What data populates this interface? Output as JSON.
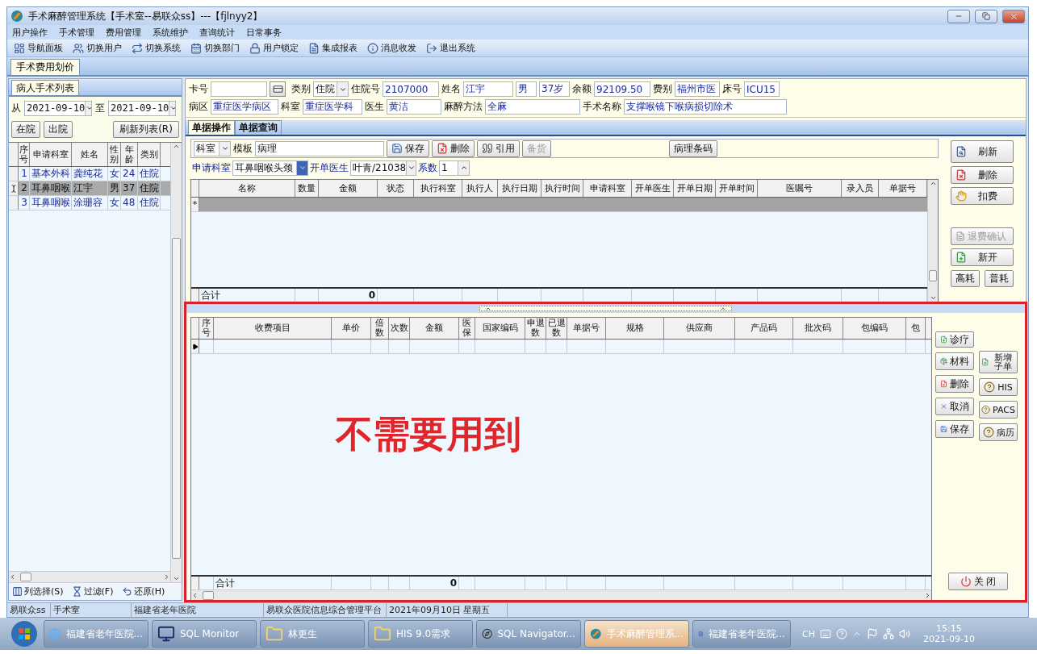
{
  "window": {
    "title": "手术麻醉管理系统【手术室--易联众ss】---【fjlnyy2】"
  },
  "menu": [
    "用户操作",
    "手术管理",
    "费用管理",
    "系统维护",
    "查询统计",
    "日常事务"
  ],
  "toolbar": [
    {
      "label": "导航面板",
      "kind": "nav"
    },
    {
      "label": "切换用户",
      "kind": "user"
    },
    {
      "label": "切换系统",
      "kind": "system"
    },
    {
      "label": "切换部门",
      "kind": "dept"
    },
    {
      "label": "用户锁定",
      "kind": "lock"
    },
    {
      "label": "集成报表",
      "kind": "report"
    },
    {
      "label": "消息收发",
      "kind": "message"
    },
    {
      "label": "退出系统",
      "kind": "exit"
    }
  ],
  "doc_tabs": [
    {
      "label": "手术费用划价",
      "selected": true
    }
  ],
  "patient_list": {
    "tab": "病人手术列表",
    "from_label": "从",
    "from": "2021-09-10",
    "to_label": "至",
    "to": "2021-09-10",
    "filters": [
      "在院",
      "出院"
    ],
    "refresh": "刷新列表(R)",
    "columns": [
      "序号",
      "申请科室",
      "姓名",
      "性别",
      "年龄",
      "类别"
    ],
    "rows": [
      {
        "cells": [
          "1",
          "基本外科",
          "龚纯花",
          "女",
          "24",
          "住院"
        ],
        "selected": false
      },
      {
        "cells": [
          "2",
          "耳鼻咽喉",
          "江宇",
          "男",
          "37",
          "住院"
        ],
        "selected": true
      },
      {
        "cells": [
          "3",
          "耳鼻咽喉",
          "涂珊容",
          "女",
          "48",
          "住院"
        ],
        "selected": false
      }
    ],
    "actions": [
      {
        "label": "列选择(S)",
        "kind": "columns"
      },
      {
        "label": "过滤(F)",
        "kind": "filter"
      },
      {
        "label": "还原(H)",
        "kind": "restore"
      }
    ]
  },
  "patient_info": {
    "lines": [
      {
        "fields": [
          {
            "label": "卡号",
            "kind": "input"
          },
          {
            "kind": "card_button"
          },
          {
            "label": "类别",
            "value": "住院",
            "kind": "select"
          },
          {
            "label": "住院号",
            "value": "2107000",
            "kind": "input"
          },
          {
            "label": "姓名",
            "value": "江宇",
            "kind": "input"
          },
          {
            "value": "男",
            "kind": "input"
          },
          {
            "value": "37岁",
            "kind": "input"
          },
          {
            "label": "余额",
            "value": "92109.50",
            "kind": "input"
          },
          {
            "label": "费别",
            "value": "福州市医",
            "kind": "input"
          },
          {
            "label": "床号",
            "value": "ICU15",
            "kind": "input"
          }
        ]
      },
      {
        "fields": [
          {
            "label": "病区",
            "value": "重症医学病区",
            "kind": "input"
          },
          {
            "label": "科室",
            "value": "重症医学科",
            "kind": "input"
          },
          {
            "label": "医生",
            "value": "黄洁",
            "kind": "input"
          },
          {
            "label": "麻醉方法",
            "value": "全麻",
            "kind": "input"
          },
          {
            "label": "手术名称",
            "value": "支撑喉镜下喉病损切除术",
            "kind": "input"
          }
        ]
      }
    ]
  },
  "order_panel": {
    "tabs": [
      {
        "label": "单据操作",
        "selected": true
      },
      {
        "label": "单据查询",
        "selected": false
      }
    ],
    "dept_select": "科室",
    "template_label": "模板",
    "template": "病理",
    "actions": [
      {
        "label": "保存",
        "kind": "save",
        "disabled": false
      },
      {
        "label": "删除",
        "kind": "delete",
        "disabled": false
      },
      {
        "label": "引用",
        "kind": "quote",
        "disabled": false
      },
      {
        "label": "备货",
        "kind": "plain",
        "disabled": true
      }
    ],
    "barcode_button": "病理条码",
    "apply_dept_label": "申请科室",
    "apply_dept": "耳鼻咽喉头颈",
    "doctor_label": "开单医生",
    "doctor": "叶青/21038",
    "factor_label": "系数",
    "factor": "1",
    "grid": {
      "columns": [
        "名称",
        "数量",
        "金额",
        "状态",
        "执行科室",
        "执行人",
        "执行日期",
        "执行时间",
        "申请科室",
        "开单医生",
        "开单日期",
        "开单时间",
        "医嘱号",
        "录入员",
        "单据号"
      ],
      "new_row_marker": "*",
      "footer": {
        "label": "合计",
        "total": "0"
      }
    },
    "side_buttons": [
      {
        "label": "刷新",
        "kind": "refresh",
        "disabled": false
      },
      {
        "label": "删除",
        "kind": "delete",
        "disabled": false
      },
      {
        "label": "扣费",
        "kind": "hand",
        "disabled": false
      },
      {
        "label": "退费确认",
        "kind": "refund",
        "disabled": true
      },
      {
        "label": "新开",
        "kind": "add",
        "disabled": false
      }
    ],
    "side_pair": [
      "高耗",
      "普耗"
    ]
  },
  "charge_panel": {
    "grid": {
      "columns": [
        "序号",
        "收费项目",
        "单价",
        "倍数",
        "次数",
        "金额",
        "医保",
        "国家编码",
        "申退数",
        "已退数",
        "单据号",
        "规格",
        "供应商",
        "产品码",
        "批次码",
        "包编码",
        "包"
      ],
      "footer": {
        "label": "合计",
        "total": "0"
      }
    },
    "buttons_left": [
      {
        "label": "诊疗",
        "kind": "add"
      },
      {
        "label": "材料",
        "kind": "material"
      },
      {
        "label": "删除",
        "kind": "delete"
      },
      {
        "label": "取消",
        "kind": "cancel"
      },
      {
        "label": "保存",
        "kind": "save"
      }
    ],
    "buttons_right": [
      {
        "label": "新增子单",
        "kind": "add"
      },
      {
        "label": "HIS",
        "kind": "help"
      },
      {
        "label": "PACS",
        "kind": "help"
      },
      {
        "label": "病历",
        "kind": "help"
      }
    ],
    "close": "关 闭"
  },
  "annotation": {
    "text": "不需要用到"
  },
  "status_bar": [
    "易联众ss",
    "手术室",
    "福建省老年医院",
    "易联众医院信息综合管理平台",
    "2021年09月10日 星期五"
  ],
  "taskbar": {
    "items": [
      {
        "label": "福建省老年医院...",
        "kind": "browser",
        "selected": false
      },
      {
        "label": "SQL Monitor",
        "kind": "monitor",
        "selected": false
      },
      {
        "label": "林更生",
        "kind": "folder",
        "selected": false
      },
      {
        "label": "HIS 9.0需求",
        "kind": "folder",
        "selected": false
      },
      {
        "label": "SQL Navigator...",
        "kind": "compass",
        "selected": false
      },
      {
        "label": "手术麻醉管理系...",
        "kind": "app",
        "selected": true
      },
      {
        "label": "福建省老年医院...",
        "kind": "document",
        "selected": false
      }
    ],
    "tray": {
      "language": "CH",
      "time": "15:15",
      "date": "2021-09-10"
    }
  }
}
